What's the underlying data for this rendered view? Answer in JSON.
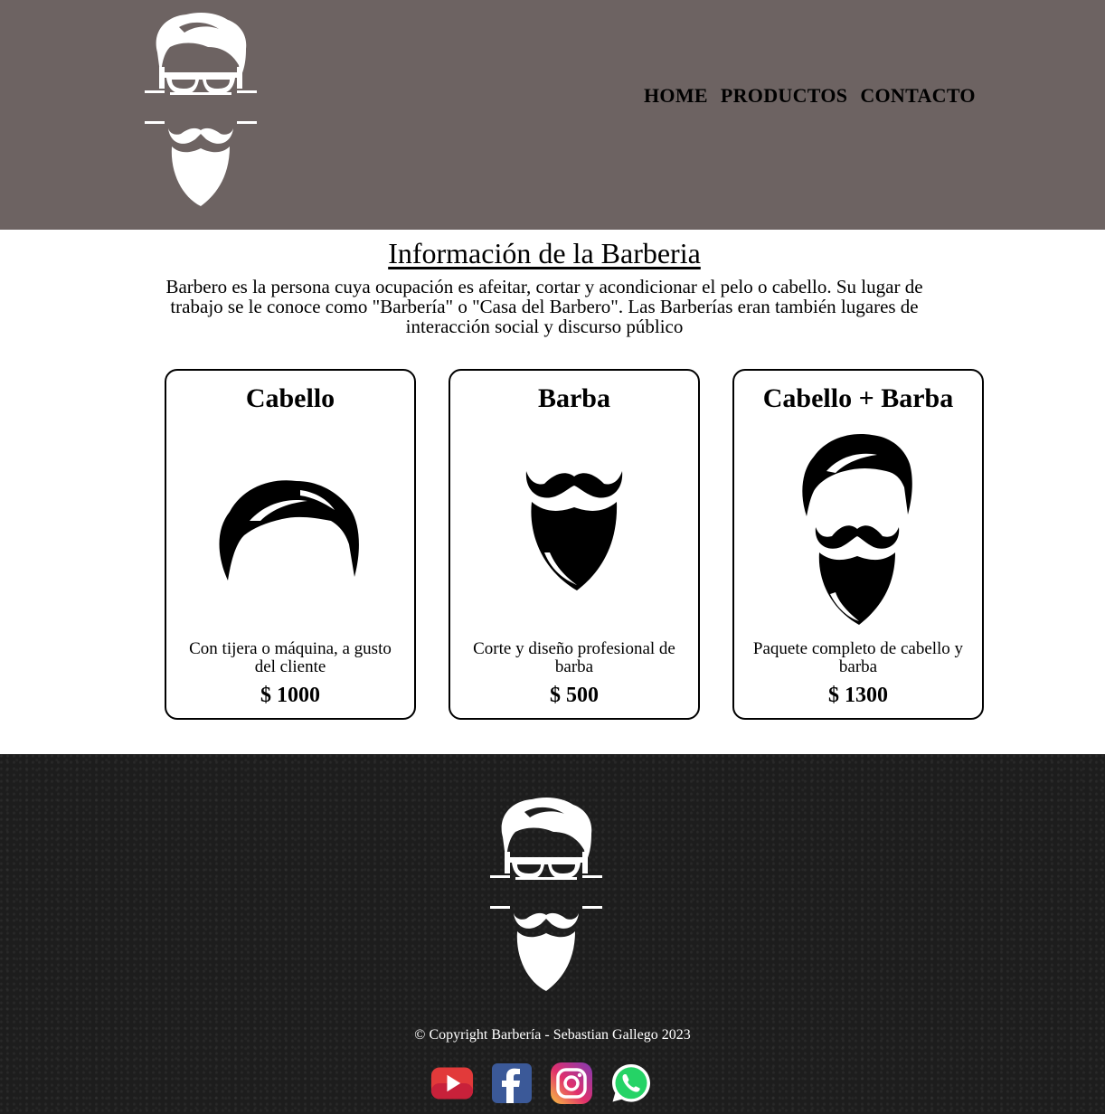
{
  "header": {
    "nav": [
      "HOME",
      "PRODUCTOS",
      "CONTACTO"
    ]
  },
  "info": {
    "title": "Información de la Barberia",
    "text": "Barbero es la persona cuya ocupación es afeitar, cortar y acondicionar el pelo o cabello. Su lugar de trabajo se le conoce como \"Barbería\" o \"Casa del Barbero\". Las Barberías eran también lugares de interacción social y discurso público"
  },
  "cards": [
    {
      "title": "Cabello",
      "desc": "Con tijera o máquina, a gusto del cliente",
      "price": "$ 1000",
      "icon": "hair-icon"
    },
    {
      "title": "Barba",
      "desc": "Corte y diseño profesional de barba",
      "price": "$ 500",
      "icon": "beard-icon"
    },
    {
      "title": "Cabello + Barba",
      "desc": "Paquete completo de cabello y barba",
      "price": "$ 1300",
      "icon": "hair-beard-icon"
    }
  ],
  "footer": {
    "copyright": "© Copyright Barbería - Sebastian Gallego 2023",
    "social": [
      "youtube-icon",
      "facebook-icon",
      "instagram-icon",
      "whatsapp-icon"
    ]
  },
  "colors": {
    "header_bg": "#6d6362",
    "footer_bg": "#1d1d1d",
    "youtube": "#e23a3a",
    "facebook": "#3b5998",
    "whatsapp": "#25d366"
  }
}
